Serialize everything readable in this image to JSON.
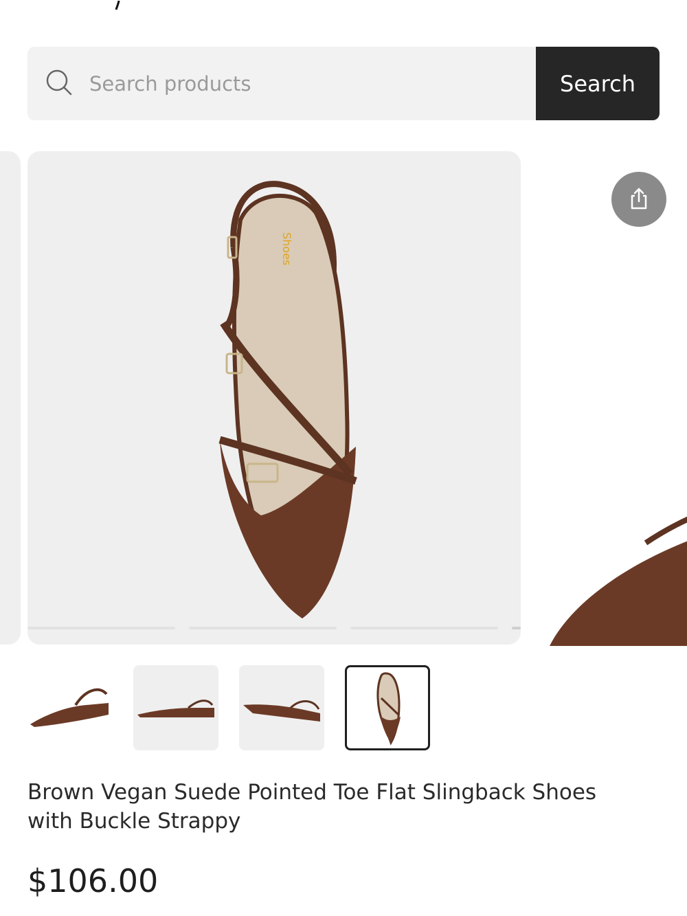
{
  "search": {
    "placeholder": "Search products",
    "button_label": "Search"
  },
  "gallery": {
    "slides_total": 4,
    "active_slide": 4
  },
  "thumbnails": [
    {
      "view": "side-left"
    },
    {
      "view": "side-right"
    },
    {
      "view": "side-angle"
    },
    {
      "view": "top-down",
      "active": true
    }
  ],
  "product": {
    "title": "Brown Vegan Suede Pointed Toe Flat Slingback Shoes with Buckle Strappy",
    "price": "$106.00",
    "color": "#6b3a26"
  },
  "icons": {
    "search": "search-icon",
    "share": "share-icon"
  }
}
